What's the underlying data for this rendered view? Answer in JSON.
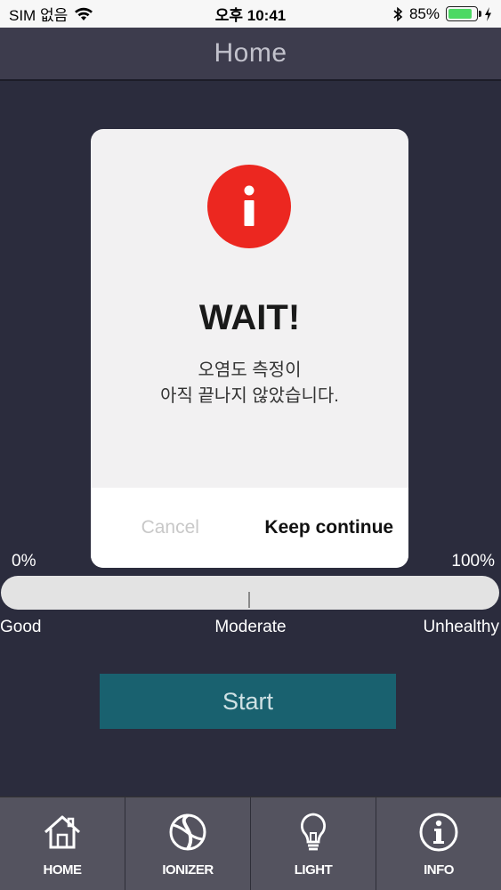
{
  "status_bar": {
    "carrier": "SIM 없음",
    "time": "오후 10:41",
    "battery": "85%",
    "battery_level": 0.85
  },
  "header": {
    "title": "Home"
  },
  "gauge": {
    "min_label": "0%",
    "max_label": "100%",
    "labels": [
      "Good",
      "Moderate",
      "Unhealthy"
    ],
    "value_fraction": 0.5
  },
  "start_button": {
    "label": "Start"
  },
  "tabs": [
    {
      "label": "HOME",
      "icon": "home-icon"
    },
    {
      "label": "IONIZER",
      "icon": "ionizer-icon"
    },
    {
      "label": "LIGHT",
      "icon": "lightbulb-icon"
    },
    {
      "label": "INFO",
      "icon": "info-icon"
    }
  ],
  "dialog": {
    "icon": "alert-info-icon",
    "title": "WAIT!",
    "message_line1": "오염도 측정이",
    "message_line2": "아직 끝나지 않았습니다.",
    "cancel_label": "Cancel",
    "confirm_label": "Keep continue"
  },
  "colors": {
    "background": "#2b2c3d",
    "header": "#3d3c4d",
    "start_button": "#19616f",
    "alert_red": "#ec2720",
    "tabbar": "#54535f"
  }
}
